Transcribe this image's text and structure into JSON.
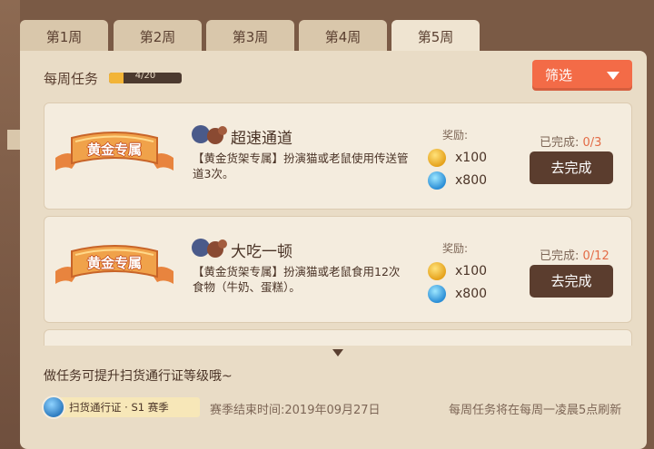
{
  "tabs": [
    "第1周",
    "第2周",
    "第3周",
    "第4周",
    "第5周"
  ],
  "active_tab": 4,
  "header": {
    "weekly_label": "每周任务",
    "progress_text": "4/20",
    "progress_value": 0.2,
    "filter_label": "筛选"
  },
  "tasks": [
    {
      "badge": "黄金专属",
      "title": "超速通道",
      "desc": "【黄金货架专属】扮演猫或老鼠使用传送管道3次。",
      "reward_label": "奖励:",
      "reward1": "x100",
      "reward2": "x800",
      "done_label": "已完成: ",
      "done_value": "0/3",
      "button": "去完成"
    },
    {
      "badge": "黄金专属",
      "title": "大吃一顿",
      "desc": "【黄金货架专属】扮演猫或老鼠食用12次食物（牛奶、蛋糕）。",
      "reward_label": "奖励:",
      "reward1": "x100",
      "reward2": "x800",
      "done_label": "已完成: ",
      "done_value": "0/12",
      "button": "去完成"
    }
  ],
  "hint": "做任务可提升扫货通行证等级哦~",
  "footer": {
    "pass_label": "扫货通行证 · S1 赛季",
    "season_end": "赛季结束时间:2019年09月27日",
    "refresh_note": "每周任务将在每周一凌晨5点刷新"
  },
  "colors": {
    "accent": "#f36b47",
    "button_dark": "#5b3d2e",
    "panel": "#e9dcc6",
    "done_value": "#e36b46"
  },
  "icons": [
    "coin-icon",
    "gem-icon",
    "cat-mouse-icon",
    "globe-icon",
    "dropdown-arrow-icon",
    "scroll-down-icon"
  ]
}
